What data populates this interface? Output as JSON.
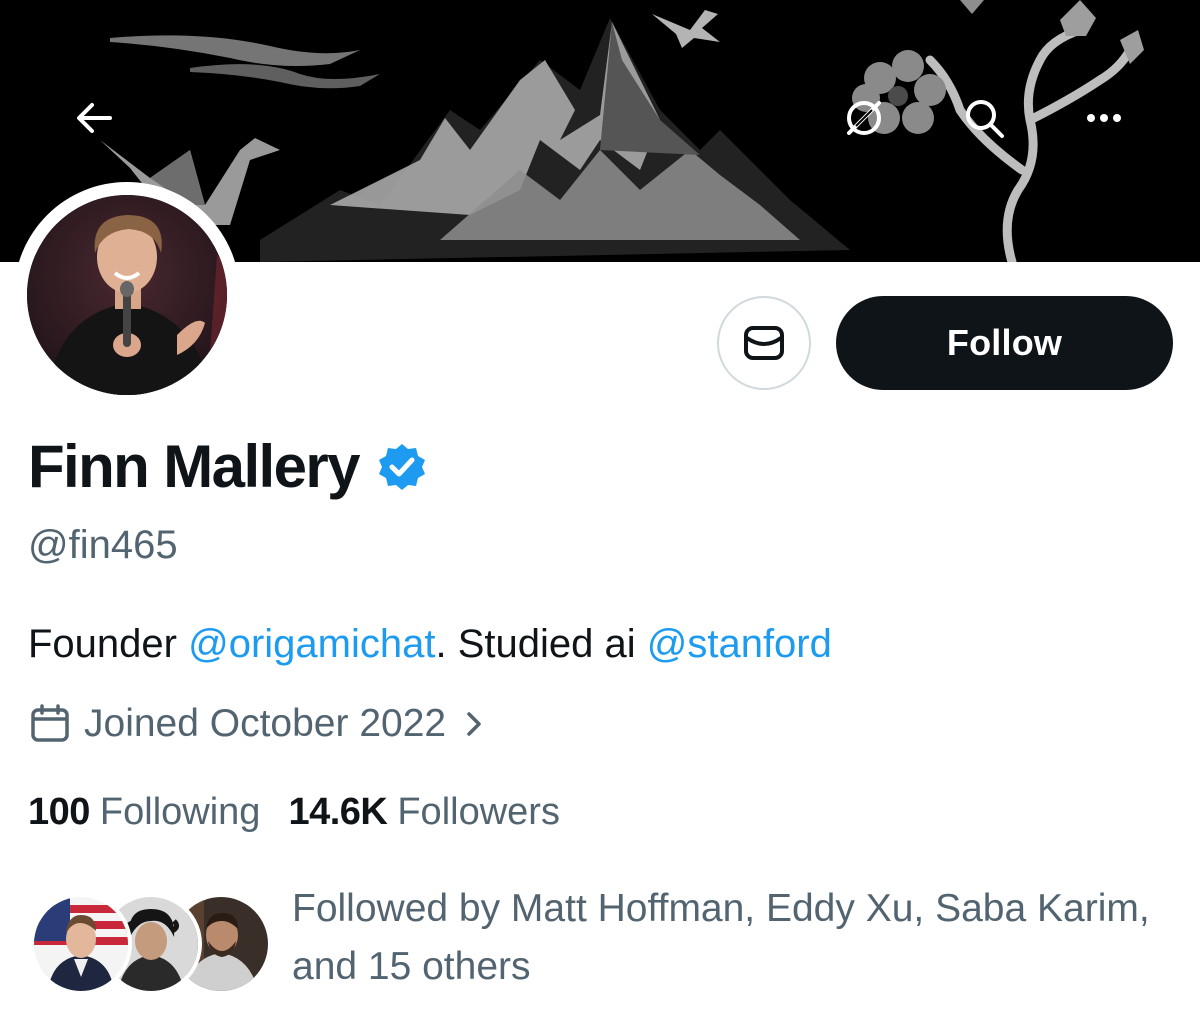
{
  "profile": {
    "display_name": "Finn Mallery",
    "handle": "@fin465",
    "bio_prefix": "Founder ",
    "bio_mention_1": "@origamichat",
    "bio_middle": ". Studied ai ",
    "bio_mention_2": "@stanford",
    "joined": "Joined October 2022",
    "verified": true
  },
  "actions": {
    "follow_label": "Follow",
    "message_icon": "envelope-icon"
  },
  "stats": {
    "following_count": "100",
    "following_label": "Following",
    "followers_count": "14.6K",
    "followers_label": "Followers"
  },
  "followed_by": {
    "text": "Followed by Matt Hoffman, Eddy Xu, Saba Karim, and 15 others"
  },
  "icons": {
    "back": "arrow-left-icon",
    "grok": "grok-icon",
    "search": "search-icon",
    "more": "more-horizontal-icon",
    "calendar": "calendar-icon",
    "chevron": "chevron-right-icon",
    "verified": "verified-badge-icon"
  },
  "colors": {
    "link": "#1d9bf0",
    "text_primary": "#0f1419",
    "text_secondary": "#536471",
    "follow_button_bg": "#0f1419",
    "banner_bg": "#000000",
    "verified_badge": "#1d9bf0"
  }
}
